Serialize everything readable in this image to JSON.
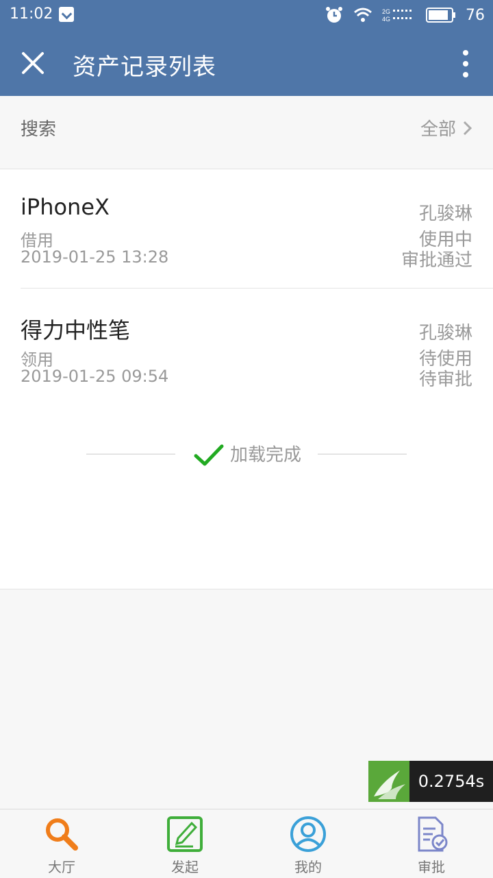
{
  "status_bar": {
    "time": "11:02",
    "battery": "76",
    "network": "2G 4G"
  },
  "app_bar": {
    "title": "资产记录列表"
  },
  "search": {
    "label": "搜索",
    "filter_label": "全部"
  },
  "records": [
    {
      "name": "iPhoneX",
      "type": "借用",
      "date": "2019-01-25 13:28",
      "user": "孔骏琳",
      "status": "使用中",
      "approval": "审批通过"
    },
    {
      "name": "得力中性笔",
      "type": "领用",
      "date": "2019-01-25 09:54",
      "user": "孔骏琳",
      "status": "待使用",
      "approval": "待审批"
    }
  ],
  "load_status": "加载完成",
  "timer": "0.2754s",
  "tabs": [
    {
      "label": "大厅",
      "icon": "search-icon",
      "color": "#f07d1a"
    },
    {
      "label": "发起",
      "icon": "edit-icon",
      "color": "#3fae3a"
    },
    {
      "label": "我的",
      "icon": "user-icon",
      "color": "#3aa0d8"
    },
    {
      "label": "审批",
      "icon": "approval-doc-icon",
      "color": "#7b86c9"
    }
  ],
  "colors": {
    "header": "#4f76a8",
    "check": "#22aa22"
  }
}
